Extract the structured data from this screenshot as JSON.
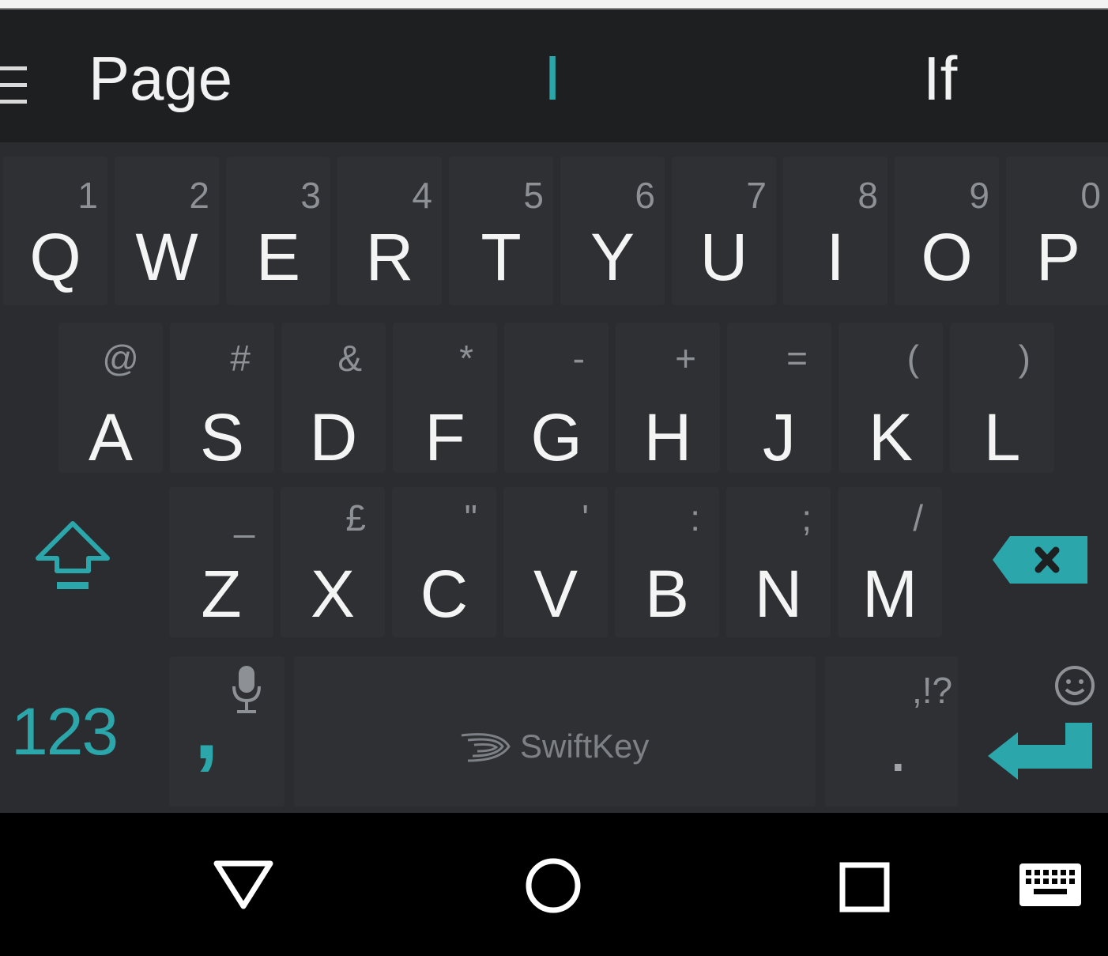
{
  "suggestions": {
    "left": "Page",
    "center": "I",
    "right": "If"
  },
  "keyboard": {
    "row1": [
      {
        "letter": "Q",
        "hint": "1"
      },
      {
        "letter": "W",
        "hint": "2"
      },
      {
        "letter": "E",
        "hint": "3"
      },
      {
        "letter": "R",
        "hint": "4"
      },
      {
        "letter": "T",
        "hint": "5"
      },
      {
        "letter": "Y",
        "hint": "6"
      },
      {
        "letter": "U",
        "hint": "7"
      },
      {
        "letter": "I",
        "hint": "8"
      },
      {
        "letter": "O",
        "hint": "9"
      },
      {
        "letter": "P",
        "hint": "0"
      }
    ],
    "row2": [
      {
        "letter": "A",
        "hint": "@"
      },
      {
        "letter": "S",
        "hint": "#"
      },
      {
        "letter": "D",
        "hint": "&"
      },
      {
        "letter": "F",
        "hint": "*"
      },
      {
        "letter": "G",
        "hint": "-"
      },
      {
        "letter": "H",
        "hint": "+"
      },
      {
        "letter": "J",
        "hint": "="
      },
      {
        "letter": "K",
        "hint": "("
      },
      {
        "letter": "L",
        "hint": ")"
      }
    ],
    "row3": [
      {
        "letter": "Z",
        "hint": "_"
      },
      {
        "letter": "X",
        "hint": "£"
      },
      {
        "letter": "C",
        "hint": "\""
      },
      {
        "letter": "V",
        "hint": "'"
      },
      {
        "letter": "B",
        "hint": ":"
      },
      {
        "letter": "N",
        "hint": ";"
      },
      {
        "letter": "M",
        "hint": "/"
      }
    ],
    "bottom": {
      "num_label": "123",
      "comma": ",",
      "brand": "SwiftKey",
      "punct_hint": ",!?",
      "period": "."
    }
  },
  "icons": {
    "menu": "menu-icon",
    "shift": "shift-icon",
    "backspace": "backspace-icon",
    "mic": "mic-icon",
    "emoji": "emoji-icon",
    "enter": "enter-icon",
    "nav_back": "nav-back-icon",
    "nav_home": "nav-home-icon",
    "nav_recents": "nav-recents-icon",
    "nav_keyboard": "keyboard-icon"
  },
  "colors": {
    "accent": "#29a8ac",
    "keyboard_bg": "#2a2c2f",
    "key_bg": "#2e3033",
    "suggestion_bar_bg": "#1d1f21",
    "navbar_bg": "#000000"
  }
}
